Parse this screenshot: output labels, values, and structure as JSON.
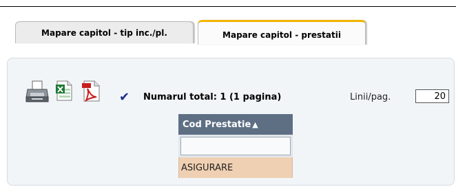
{
  "tabs": [
    {
      "label": "Mapare capitol - tip inc./pl.",
      "active": false
    },
    {
      "label": "Mapare capitol - prestatii",
      "active": true
    }
  ],
  "toolbar": {
    "icons": [
      "printer-icon",
      "excel-icon",
      "pdf-icon",
      "check-icon"
    ],
    "total_text": "Numarul total: 1 (1 pagina)",
    "rows_per_page_label": "Linii/pag.",
    "rows_per_page_value": "20"
  },
  "grid": {
    "column_header": "Cod Prestatie",
    "sort_direction": "ascending",
    "filter_value": "",
    "rows": [
      "ASIGURARE"
    ]
  },
  "colors": {
    "active_tab_accent": "#f1b500",
    "header_bg": "#5e6f84",
    "selected_row_bg": "#f0d0b3"
  }
}
